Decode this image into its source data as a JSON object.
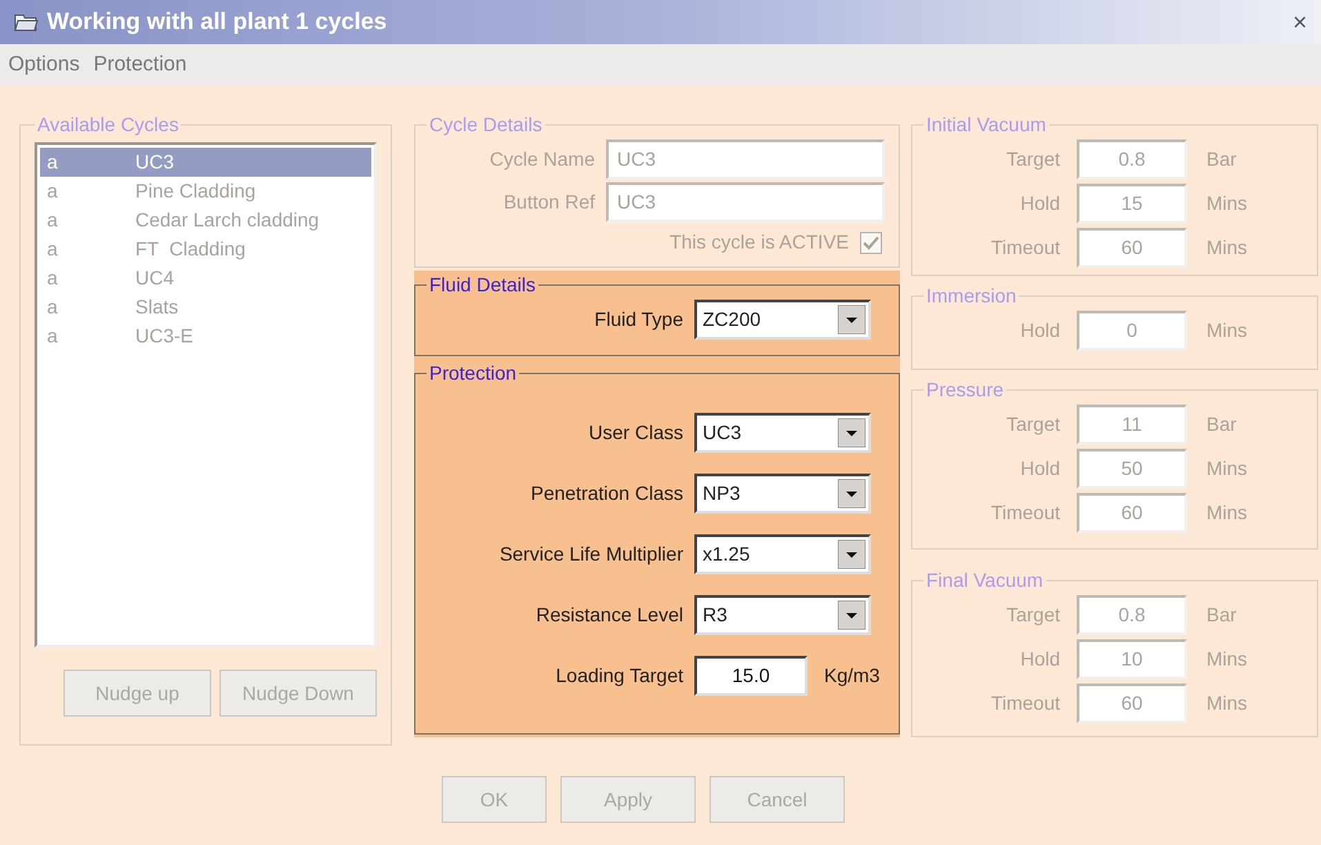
{
  "window": {
    "title": "Working with all plant 1 cycles",
    "close": "×"
  },
  "menu": [
    {
      "label": "Options"
    },
    {
      "label": "Protection"
    }
  ],
  "available_cycles": {
    "title": "Available Cycles",
    "disabled": true,
    "items": [
      {
        "flag": "a",
        "name": "UC3",
        "selected": true
      },
      {
        "flag": "a",
        "name": "Pine Cladding",
        "selected": false
      },
      {
        "flag": "a",
        "name": "Cedar Larch cladding",
        "selected": false
      },
      {
        "flag": "a",
        "name": "FT  Cladding",
        "selected": false
      },
      {
        "flag": "a",
        "name": "UC4",
        "selected": false
      },
      {
        "flag": "a",
        "name": "Slats",
        "selected": false
      },
      {
        "flag": "a",
        "name": "UC3-E",
        "selected": false
      }
    ],
    "buttons": [
      {
        "label": "Nudge up",
        "disabled": true
      },
      {
        "label": "Nudge Down",
        "disabled": true
      }
    ]
  },
  "cycle_details": {
    "title": "Cycle Details",
    "disabled": true,
    "fields": [
      {
        "label": "Cycle Name",
        "value": "UC3"
      },
      {
        "label": "Button Ref",
        "value": "UC3"
      }
    ],
    "active": {
      "label": "This cycle is ACTIVE",
      "checked": true
    }
  },
  "fluid_details": {
    "title": "Fluid Details",
    "disabled": false,
    "rows": [
      {
        "kind": "dropdown",
        "label": "Fluid Type",
        "value": "ZC200"
      }
    ]
  },
  "protection": {
    "title": "Protection",
    "disabled": false,
    "rows": [
      {
        "kind": "dropdown",
        "label": "User Class",
        "value": "UC3"
      },
      {
        "kind": "dropdown",
        "label": "Penetration Class",
        "value": "NP3"
      },
      {
        "kind": "dropdown",
        "label": "Service Life Multiplier",
        "value": "x1.25"
      },
      {
        "kind": "dropdown",
        "label": "Resistance Level",
        "value": "R3"
      },
      {
        "kind": "input",
        "label": "Loading Target",
        "value": "15.0",
        "unit": "Kg/m3"
      }
    ]
  },
  "stages": [
    {
      "title": "Initial Vacuum",
      "disabled": true,
      "rows": [
        {
          "label": "Target",
          "value": "0.8",
          "unit": "Bar"
        },
        {
          "label": "Hold",
          "value": "15",
          "unit": "Mins"
        },
        {
          "label": "Timeout",
          "value": "60",
          "unit": "Mins"
        }
      ]
    },
    {
      "title": "Immersion",
      "disabled": true,
      "rows": [
        {
          "label": "Hold",
          "value": "0",
          "unit": "Mins"
        }
      ]
    },
    {
      "title": "Pressure",
      "disabled": true,
      "rows": [
        {
          "label": "Target",
          "value": "11",
          "unit": "Bar"
        },
        {
          "label": "Hold",
          "value": "50",
          "unit": "Mins"
        },
        {
          "label": "Timeout",
          "value": "60",
          "unit": "Mins"
        }
      ]
    },
    {
      "title": "Final Vacuum",
      "disabled": true,
      "rows": [
        {
          "label": "Target",
          "value": "0.8",
          "unit": "Bar"
        },
        {
          "label": "Hold",
          "value": "10",
          "unit": "Mins"
        },
        {
          "label": "Timeout",
          "value": "60",
          "unit": "Mins"
        }
      ]
    }
  ],
  "buttons": [
    {
      "label": "OK",
      "disabled": true
    },
    {
      "label": "Apply",
      "disabled": true
    },
    {
      "label": "Cancel",
      "disabled": true
    }
  ]
}
